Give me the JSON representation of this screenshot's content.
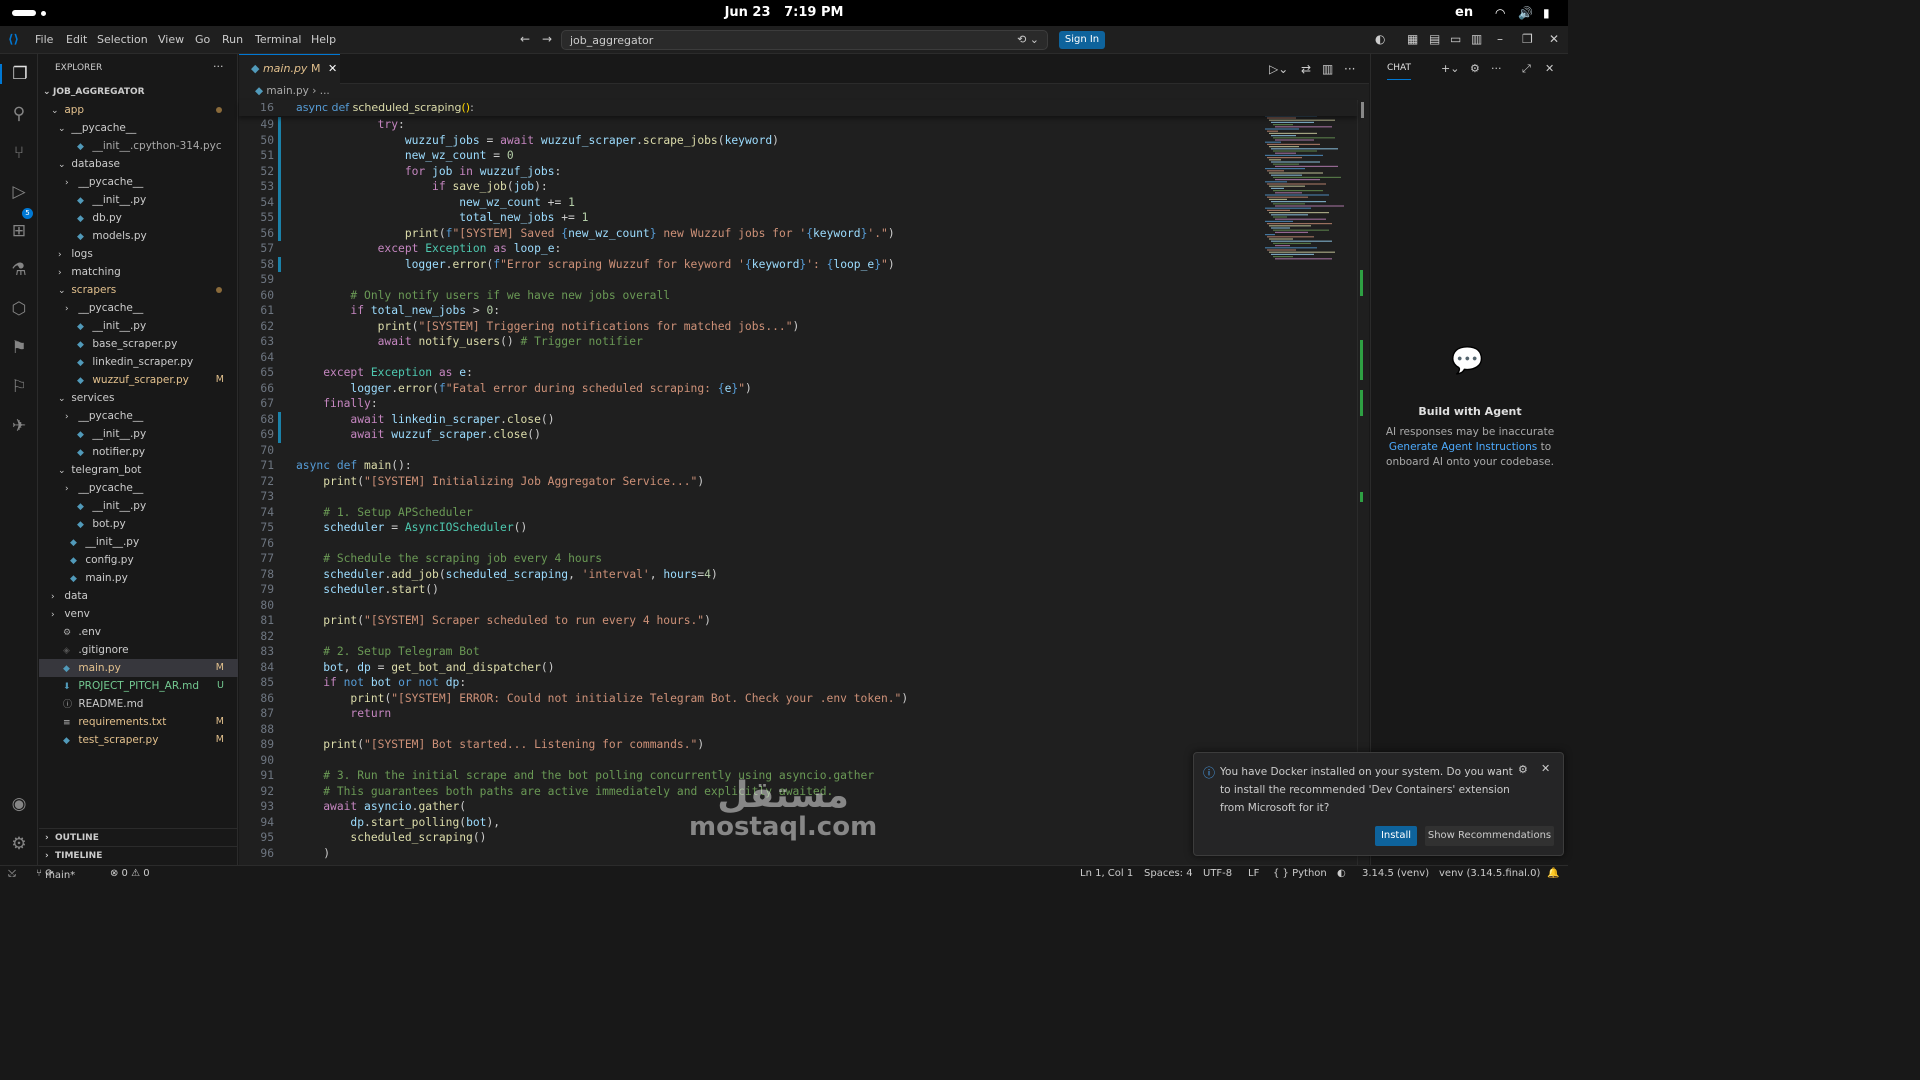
{
  "system": {
    "date": "Jun 23",
    "time": "7:19 PM",
    "lang": "en"
  },
  "menu": [
    "File",
    "Edit",
    "Selection",
    "View",
    "Go",
    "Run",
    "Terminal",
    "Help"
  ],
  "command_center": "job_aggregator",
  "sign_in": "Sign In",
  "source_control_badge": "5",
  "explorer": {
    "title": "EXPLORER",
    "root": "JOB_AGGREGATOR",
    "items": [
      {
        "label": "app",
        "indent": 0,
        "type": "folder-open",
        "marker": "dot",
        "cls": "mod"
      },
      {
        "label": "__pycache__",
        "indent": 1,
        "type": "folder-open"
      },
      {
        "label": "__init__.cpython-314.pyc",
        "indent": 2,
        "type": "file",
        "cls": "dim"
      },
      {
        "label": "database",
        "indent": 1,
        "type": "folder-open"
      },
      {
        "label": "__pycache__",
        "indent": 2,
        "type": "folder"
      },
      {
        "label": "__init__.py",
        "indent": 2,
        "type": "file"
      },
      {
        "label": "db.py",
        "indent": 2,
        "type": "file"
      },
      {
        "label": "models.py",
        "indent": 2,
        "type": "file"
      },
      {
        "label": "logs",
        "indent": 1,
        "type": "folder"
      },
      {
        "label": "matching",
        "indent": 1,
        "type": "folder"
      },
      {
        "label": "scrapers",
        "indent": 1,
        "type": "folder-open",
        "marker": "dot",
        "cls": "mod"
      },
      {
        "label": "__pycache__",
        "indent": 2,
        "type": "folder"
      },
      {
        "label": "__init__.py",
        "indent": 2,
        "type": "file"
      },
      {
        "label": "base_scraper.py",
        "indent": 2,
        "type": "file"
      },
      {
        "label": "linkedin_scraper.py",
        "indent": 2,
        "type": "file"
      },
      {
        "label": "wuzzuf_scraper.py",
        "indent": 2,
        "type": "file",
        "marker": "M",
        "cls": "mod"
      },
      {
        "label": "services",
        "indent": 1,
        "type": "folder-open"
      },
      {
        "label": "__pycache__",
        "indent": 2,
        "type": "folder"
      },
      {
        "label": "__init__.py",
        "indent": 2,
        "type": "file"
      },
      {
        "label": "notifier.py",
        "indent": 2,
        "type": "file"
      },
      {
        "label": "telegram_bot",
        "indent": 1,
        "type": "folder-open"
      },
      {
        "label": "__pycache__",
        "indent": 2,
        "type": "folder"
      },
      {
        "label": "__init__.py",
        "indent": 2,
        "type": "file"
      },
      {
        "label": "bot.py",
        "indent": 2,
        "type": "file"
      },
      {
        "label": "__init__.py",
        "indent": 1,
        "type": "file"
      },
      {
        "label": "config.py",
        "indent": 1,
        "type": "file"
      },
      {
        "label": "main.py",
        "indent": 1,
        "type": "file"
      },
      {
        "label": "data",
        "indent": 0,
        "type": "folder"
      },
      {
        "label": "venv",
        "indent": 0,
        "type": "folder"
      },
      {
        "label": ".env",
        "indent": 0,
        "type": "gear"
      },
      {
        "label": ".gitignore",
        "indent": 0,
        "type": "git"
      },
      {
        "label": "main.py",
        "indent": 0,
        "type": "file",
        "marker": "M",
        "cls": "mod",
        "selected": true
      },
      {
        "label": "PROJECT_PITCH_AR.md",
        "indent": 0,
        "type": "md",
        "marker": "U",
        "cls": "unt"
      },
      {
        "label": "README.md",
        "indent": 0,
        "type": "info"
      },
      {
        "label": "requirements.txt",
        "indent": 0,
        "type": "txt",
        "marker": "M",
        "cls": "mod"
      },
      {
        "label": "test_scraper.py",
        "indent": 0,
        "type": "file",
        "marker": "M",
        "cls": "mod"
      }
    ],
    "outline": "OUTLINE",
    "timeline": "TIMELINE"
  },
  "tab": {
    "name": "main.py",
    "flag": "M"
  },
  "breadcrumb": "main.py  ›  ...",
  "code": {
    "sticky": {
      "n": "16",
      "html": "<span class='kw'>async</span> <span class='kw'>def</span> <span class='fn'>scheduled_scraping</span><span class='br'>()</span>:"
    },
    "lines": [
      {
        "n": "49",
        "g": "b",
        "html": "            <span class='kc'>try</span>:"
      },
      {
        "n": "50",
        "g": "b",
        "html": "                <span class='va'>wuzzuf_jobs</span> = <span class='kc'>await</span> <span class='va'>wuzzuf_scraper</span>.<span class='fn'>scrape_jobs</span>(<span class='va'>keyword</span>)"
      },
      {
        "n": "51",
        "g": "b",
        "html": "                <span class='va'>new_wz_count</span> = <span class='nu'>0</span>"
      },
      {
        "n": "52",
        "g": "b",
        "html": "                <span class='kc'>for</span> <span class='va'>job</span> <span class='kc'>in</span> <span class='va'>wuzzuf_jobs</span>:"
      },
      {
        "n": "53",
        "g": "b",
        "html": "                    <span class='kc'>if</span> <span class='fn'>save_job</span>(<span class='va'>job</span>):"
      },
      {
        "n": "54",
        "g": "b",
        "html": "                        <span class='va'>new_wz_count</span> += <span class='nu'>1</span>"
      },
      {
        "n": "55",
        "g": "b",
        "html": "                        <span class='va'>total_new_jobs</span> += <span class='nu'>1</span>"
      },
      {
        "n": "56",
        "g": "b",
        "html": "                <span class='fn'>print</span>(<span class='kw'>f</span><span class='st'>\"[SYSTEM] Saved </span><span class='kw'>{</span><span class='va'>new_wz_count</span><span class='kw'>}</span><span class='st'> new Wuzzuf jobs for '</span><span class='kw'>{</span><span class='va'>keyword</span><span class='kw'>}</span><span class='st'>'.\"</span>)"
      },
      {
        "n": "57",
        "g": "",
        "html": "            <span class='kc'>except</span> <span class='cl'>Exception</span> <span class='kc'>as</span> <span class='va'>loop_e</span>:"
      },
      {
        "n": "58",
        "g": "b",
        "html": "                <span class='va'>logger</span>.<span class='fn'>error</span>(<span class='kw'>f</span><span class='st'>\"Error scraping Wuzzuf for keyword '</span><span class='kw'>{</span><span class='va'>keyword</span><span class='kw'>}</span><span class='st'>': </span><span class='kw'>{</span><span class='va'>loop_e</span><span class='kw'>}</span><span class='st'>\"</span>)"
      },
      {
        "n": "59",
        "g": "",
        "html": ""
      },
      {
        "n": "60",
        "g": "",
        "html": "        <span class='cm'># Only notify users if we have new jobs overall</span>"
      },
      {
        "n": "61",
        "g": "",
        "html": "        <span class='kc'>if</span> <span class='va'>total_new_jobs</span> &gt; <span class='nu'>0</span>:"
      },
      {
        "n": "62",
        "g": "",
        "html": "            <span class='fn'>print</span>(<span class='st'>\"[SYSTEM] Triggering notifications for matched jobs...\"</span>)"
      },
      {
        "n": "63",
        "g": "",
        "html": "            <span class='kc'>await</span> <span class='fn'>notify_users</span>() <span class='cm'># Trigger notifier</span>"
      },
      {
        "n": "64",
        "g": "",
        "html": ""
      },
      {
        "n": "65",
        "g": "",
        "html": "    <span class='kc'>except</span> <span class='cl'>Exception</span> <span class='kc'>as</span> <span class='va'>e</span>:"
      },
      {
        "n": "66",
        "g": "",
        "html": "        <span class='va'>logger</span>.<span class='fn'>error</span>(<span class='kw'>f</span><span class='st'>\"Fatal error during scheduled scraping: </span><span class='kw'>{</span><span class='va'>e</span><span class='kw'>}</span><span class='st'>\"</span>)"
      },
      {
        "n": "67",
        "g": "",
        "html": "    <span class='kc'>finally</span>:"
      },
      {
        "n": "68",
        "g": "b",
        "html": "        <span class='kc'>await</span> <span class='va'>linkedin_scraper</span>.<span class='fn'>close</span>()"
      },
      {
        "n": "69",
        "g": "b",
        "html": "        <span class='kc'>await</span> <span class='va'>wuzzuf_scraper</span>.<span class='fn'>close</span>()"
      },
      {
        "n": "70",
        "g": "",
        "html": ""
      },
      {
        "n": "71",
        "g": "",
        "html": "<span class='kw'>async</span> <span class='kw'>def</span> <span class='fn'>main</span>():"
      },
      {
        "n": "72",
        "g": "",
        "html": "    <span class='fn'>print</span>(<span class='st'>\"[SYSTEM] Initializing Job Aggregator Service...\"</span>)"
      },
      {
        "n": "73",
        "g": "",
        "html": ""
      },
      {
        "n": "74",
        "g": "",
        "html": "    <span class='cm'># 1. Setup APScheduler</span>"
      },
      {
        "n": "75",
        "g": "",
        "html": "    <span class='va'>scheduler</span> = <span class='cl'>AsyncIOScheduler</span>()"
      },
      {
        "n": "76",
        "g": "",
        "html": ""
      },
      {
        "n": "77",
        "g": "",
        "html": "    <span class='cm'># Schedule the scraping job every 4 hours</span>"
      },
      {
        "n": "78",
        "g": "",
        "html": "    <span class='va'>scheduler</span>.<span class='fn'>add_job</span>(<span class='va'>scheduled_scraping</span>, <span class='st'>'interval'</span>, <span class='va'>hours</span>=<span class='nu'>4</span>)"
      },
      {
        "n": "79",
        "g": "",
        "html": "    <span class='va'>scheduler</span>.<span class='fn'>start</span>()"
      },
      {
        "n": "80",
        "g": "",
        "html": ""
      },
      {
        "n": "81",
        "g": "",
        "html": "    <span class='fn'>print</span>(<span class='st'>\"[SYSTEM] Scraper scheduled to run every 4 hours.\"</span>)"
      },
      {
        "n": "82",
        "g": "",
        "html": ""
      },
      {
        "n": "83",
        "g": "",
        "html": "    <span class='cm'># 2. Setup Telegram Bot</span>"
      },
      {
        "n": "84",
        "g": "",
        "html": "    <span class='va'>bot</span>, <span class='va'>dp</span> = <span class='fn'>get_bot_and_dispatcher</span>()"
      },
      {
        "n": "85",
        "g": "",
        "html": "    <span class='kc'>if</span> <span class='kw'>not</span> <span class='va'>bot</span> <span class='kw'>or</span> <span class='kw'>not</span> <span class='va'>dp</span>:"
      },
      {
        "n": "86",
        "g": "",
        "html": "        <span class='fn'>print</span>(<span class='st'>\"[SYSTEM] ERROR: Could not initialize Telegram Bot. Check your .env token.\"</span>)"
      },
      {
        "n": "87",
        "g": "",
        "html": "        <span class='kc'>return</span>"
      },
      {
        "n": "88",
        "g": "",
        "html": ""
      },
      {
        "n": "89",
        "g": "",
        "html": "    <span class='fn'>print</span>(<span class='st'>\"[SYSTEM] Bot started... Listening for commands.\"</span>)"
      },
      {
        "n": "90",
        "g": "",
        "html": ""
      },
      {
        "n": "91",
        "g": "",
        "html": "    <span class='cm'># 3. Run the initial scrape and the bot polling concurrently using asyncio.gather</span>"
      },
      {
        "n": "92",
        "g": "",
        "html": "    <span class='cm'># This guarantees both paths are active immediately and explicitly awaited.</span>"
      },
      {
        "n": "93",
        "g": "",
        "html": "    <span class='kc'>await</span> <span class='va'>asyncio</span>.<span class='fn'>gather</span>("
      },
      {
        "n": "94",
        "g": "",
        "html": "        <span class='va'>dp</span>.<span class='fn'>start_polling</span>(<span class='va'>bot</span>),"
      },
      {
        "n": "95",
        "g": "",
        "html": "        <span class='fn'>scheduled_scraping</span>()"
      },
      {
        "n": "96",
        "g": "",
        "html": "    )"
      }
    ]
  },
  "chat": {
    "tab": "CHAT",
    "title": "Build with Agent",
    "line1": "AI responses may be inaccurate",
    "link": "Generate Agent Instructions",
    "line2": " to onboard AI onto your codebase."
  },
  "notification": {
    "message": "You have Docker installed on your system. Do you want to install the recommended 'Dev Containers' extension from Microsoft for it?",
    "install": "Install",
    "show": "Show Recommendations"
  },
  "status": {
    "branch": "main*",
    "problems": "⊗ 0 ⚠ 0",
    "cursor": "Ln 1, Col 1",
    "spaces": "Spaces: 4",
    "encoding": "UTF-8",
    "eol": "LF",
    "language": "{ } Python",
    "version": "3.14.5 (venv)",
    "interpreter": "venv (3.14.5.final.0)"
  },
  "watermark": {
    "arabic": "مستقل",
    "latin": "mostaql.com"
  },
  "colors": {
    "accent": "#0078d4",
    "modified": "#e2c08d",
    "untracked": "#73c991"
  }
}
